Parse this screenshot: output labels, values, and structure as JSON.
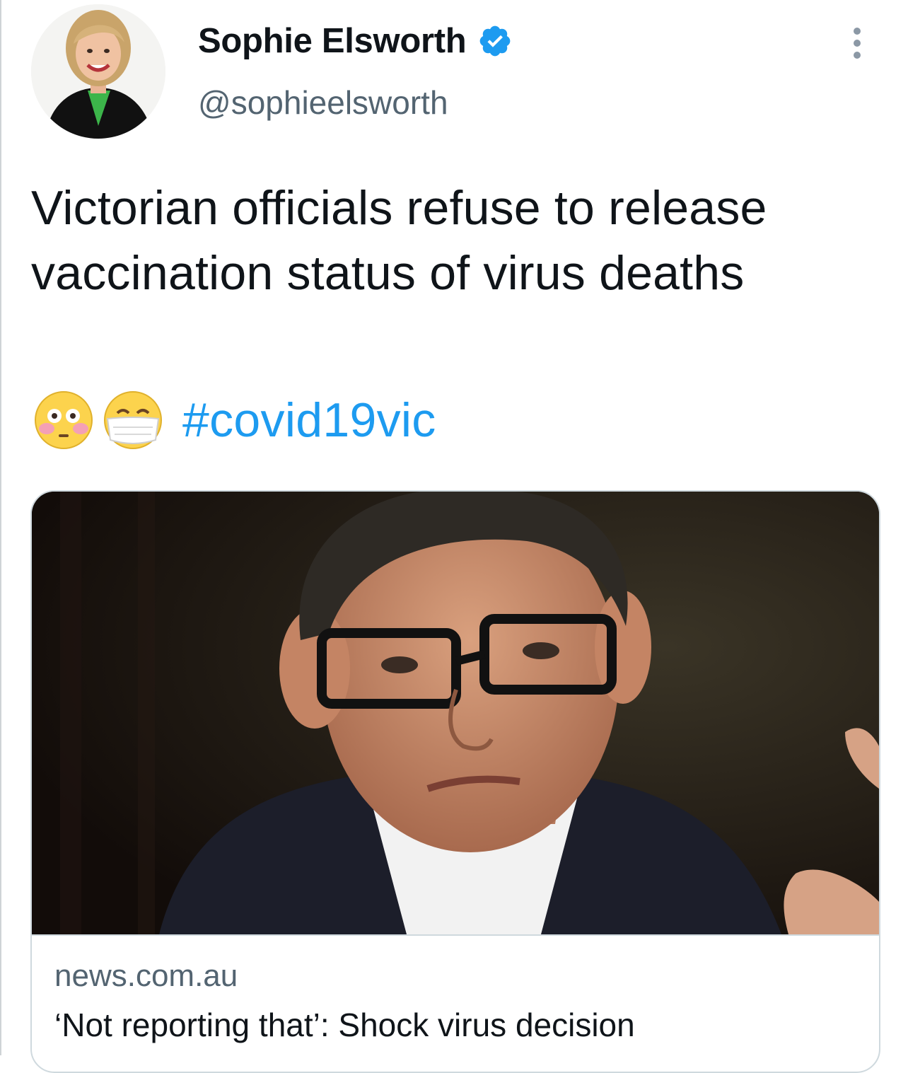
{
  "tweet": {
    "author": {
      "display_name": "Sophie Elsworth",
      "handle": "@sophieelsworth",
      "verified": true,
      "avatar_icon": "profile-photo"
    },
    "text": "Victorian officials refuse to release vaccination status of virus deaths",
    "emojis": [
      "flushed-face-emoji",
      "face-with-medical-mask-emoji"
    ],
    "hashtag": "#covid19vic",
    "more_icon": "more-options-icon"
  },
  "link_card": {
    "image": "man-with-glasses-photo",
    "domain": "news.com.au",
    "title": "‘Not reporting that’: Shock virus decision"
  },
  "colors": {
    "accent": "#1d9bf0",
    "secondary_text": "#536471",
    "primary_text": "#0f1419",
    "border": "#cfd9de"
  }
}
